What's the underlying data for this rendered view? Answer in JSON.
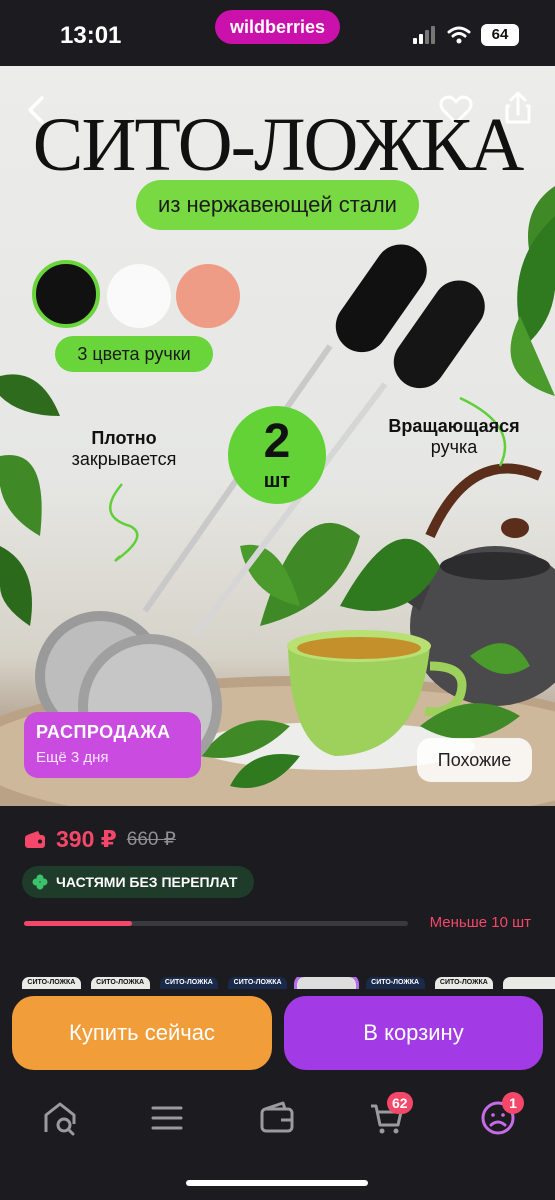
{
  "status_bar": {
    "time": "13:01",
    "brand": "wildberries",
    "battery": "64"
  },
  "hero": {
    "title": "СИТО-ЛОЖКА",
    "material": "из нержавеющей стали",
    "colors_label": "3 цвета ручки",
    "count_number": "2",
    "count_unit": "шт",
    "feature_left_bold": "Плотно",
    "feature_left_text": "закрывается",
    "feature_right_bold": "Вращающаяся",
    "feature_right_text": "ручка",
    "sale_title": "РАСПРОДАЖА",
    "sale_subtitle": "Ещё 3 дня",
    "similar_label": "Похожие",
    "swatch_colors": [
      "#111111",
      "#fafafa",
      "#ee9c86"
    ]
  },
  "price": {
    "current": "390 ₽",
    "old": "660 ₽",
    "installment": "ЧАСТЯМИ БЕЗ ПЕРЕПЛАТ",
    "stock_text": "Меньше 10 шт",
    "stock_level": 0.28
  },
  "thumbnails": [
    "СИТО-ЛОЖКА",
    "СИТО-ЛОЖКА",
    "СИТО-ЛОЖКА",
    "СИТО-ЛОЖКА",
    "",
    "СИТО-ЛОЖКА",
    "СИТО-ЛОЖКА",
    ""
  ],
  "actions": {
    "buy_now": "Купить сейчас",
    "add_to_cart": "В корзину"
  },
  "tabbar": {
    "cart_badge": "62",
    "profile_badge": "1"
  },
  "colors": {
    "accent": "#cb11ab",
    "price": "#f4476a",
    "buy": "#f19d3a",
    "cart": "#a23be6",
    "green": "#6ad43b"
  }
}
